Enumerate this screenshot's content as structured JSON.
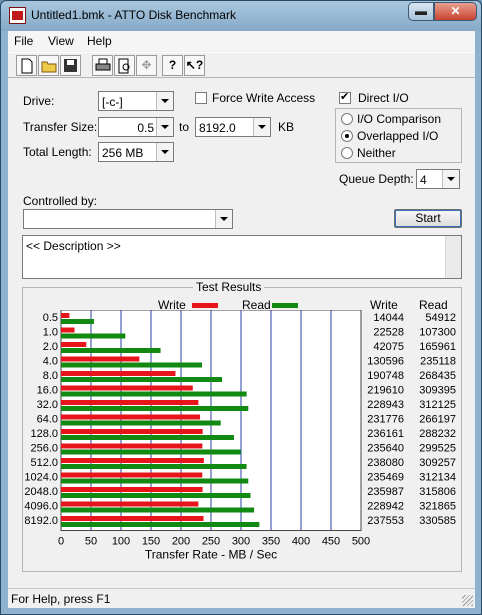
{
  "window": {
    "title": "Untitled1.bmk - ATTO Disk Benchmark",
    "min_icon": "minimize-icon",
    "close_icon": "close-icon"
  },
  "menu": {
    "items": [
      "File",
      "View",
      "Help"
    ]
  },
  "toolbar": {
    "icons": [
      "new-document-icon",
      "open-folder-icon",
      "save-icon",
      "print-icon",
      "print-preview-icon",
      "move-icon",
      "help-icon",
      "context-help-icon"
    ]
  },
  "settings": {
    "drive_label": "Drive:",
    "drive_value": "[-c-]",
    "force_write_label": "Force Write Access",
    "force_write_checked": false,
    "direct_io_label": "Direct I/O",
    "direct_io_checked": true,
    "transfer_size_label": "Transfer Size:",
    "transfer_from": "0.5",
    "to_label": "to",
    "transfer_to": "8192.0",
    "kb_label": "KB",
    "total_length_label": "Total Length:",
    "total_length_value": "256 MB",
    "io_options": [
      "I/O Comparison",
      "Overlapped I/O",
      "Neither"
    ],
    "io_selected": "Overlapped I/O",
    "queue_depth_label": "Queue Depth:",
    "queue_depth_value": "4",
    "controlled_by_label": "Controlled by:",
    "controlled_by_value": "",
    "start_label": "Start",
    "description_text": "<< Description >>"
  },
  "results": {
    "group_title": "Test Results",
    "write_legend": "Write",
    "read_legend": "Read",
    "write_col": "Write",
    "read_col": "Read",
    "write_color": "#e8141b",
    "read_color": "#128a12"
  },
  "chart_data": {
    "type": "bar",
    "orientation": "horizontal",
    "xlabel": "Transfer Rate - MB / Sec",
    "xlim": [
      0,
      500
    ],
    "xticks": [
      0,
      50,
      100,
      150,
      200,
      250,
      300,
      350,
      400,
      450,
      500
    ],
    "categories": [
      "0.5",
      "1.0",
      "2.0",
      "4.0",
      "8.0",
      "16.0",
      "32.0",
      "64.0",
      "128.0",
      "256.0",
      "512.0",
      "1024.0",
      "2048.0",
      "4096.0",
      "8192.0"
    ],
    "series": [
      {
        "name": "Write",
        "values": [
          14044,
          22528,
          42075,
          130596,
          190748,
          219610,
          228943,
          231776,
          236161,
          235640,
          238080,
          235469,
          235987,
          228942,
          237553
        ]
      },
      {
        "name": "Read",
        "values": [
          54912,
          107300,
          165961,
          235118,
          268435,
          309395,
          312125,
          266197,
          288232,
          299525,
          309257,
          312134,
          315806,
          321865,
          330585
        ]
      }
    ],
    "value_scale_note_unit": "KB/s"
  },
  "status": {
    "text": "For Help, press F1"
  }
}
